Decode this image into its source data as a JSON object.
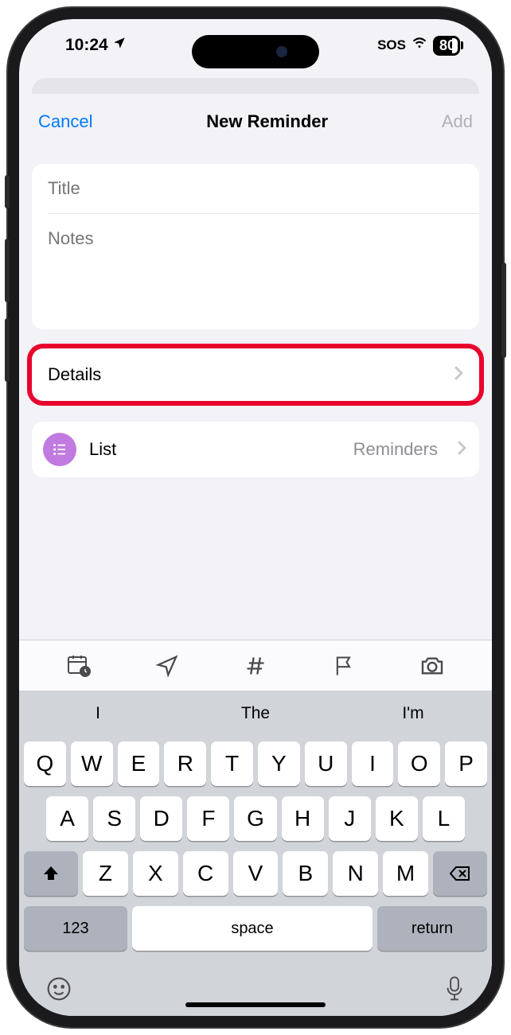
{
  "status": {
    "time": "10:24",
    "sos": "SOS",
    "battery": "80"
  },
  "header": {
    "cancel": "Cancel",
    "title": "New Reminder",
    "add": "Add"
  },
  "fields": {
    "title_placeholder": "Title",
    "notes_placeholder": "Notes"
  },
  "details": {
    "label": "Details"
  },
  "list": {
    "label": "List",
    "value": "Reminders"
  },
  "suggestions": {
    "s1": "I",
    "s2": "The",
    "s3": "I'm"
  },
  "keyboard": {
    "row1": [
      "Q",
      "W",
      "E",
      "R",
      "T",
      "Y",
      "U",
      "I",
      "O",
      "P"
    ],
    "row2": [
      "A",
      "S",
      "D",
      "F",
      "G",
      "H",
      "J",
      "K",
      "L"
    ],
    "row3": [
      "Z",
      "X",
      "C",
      "V",
      "B",
      "N",
      "M"
    ],
    "num": "123",
    "space": "space",
    "ret": "return"
  }
}
